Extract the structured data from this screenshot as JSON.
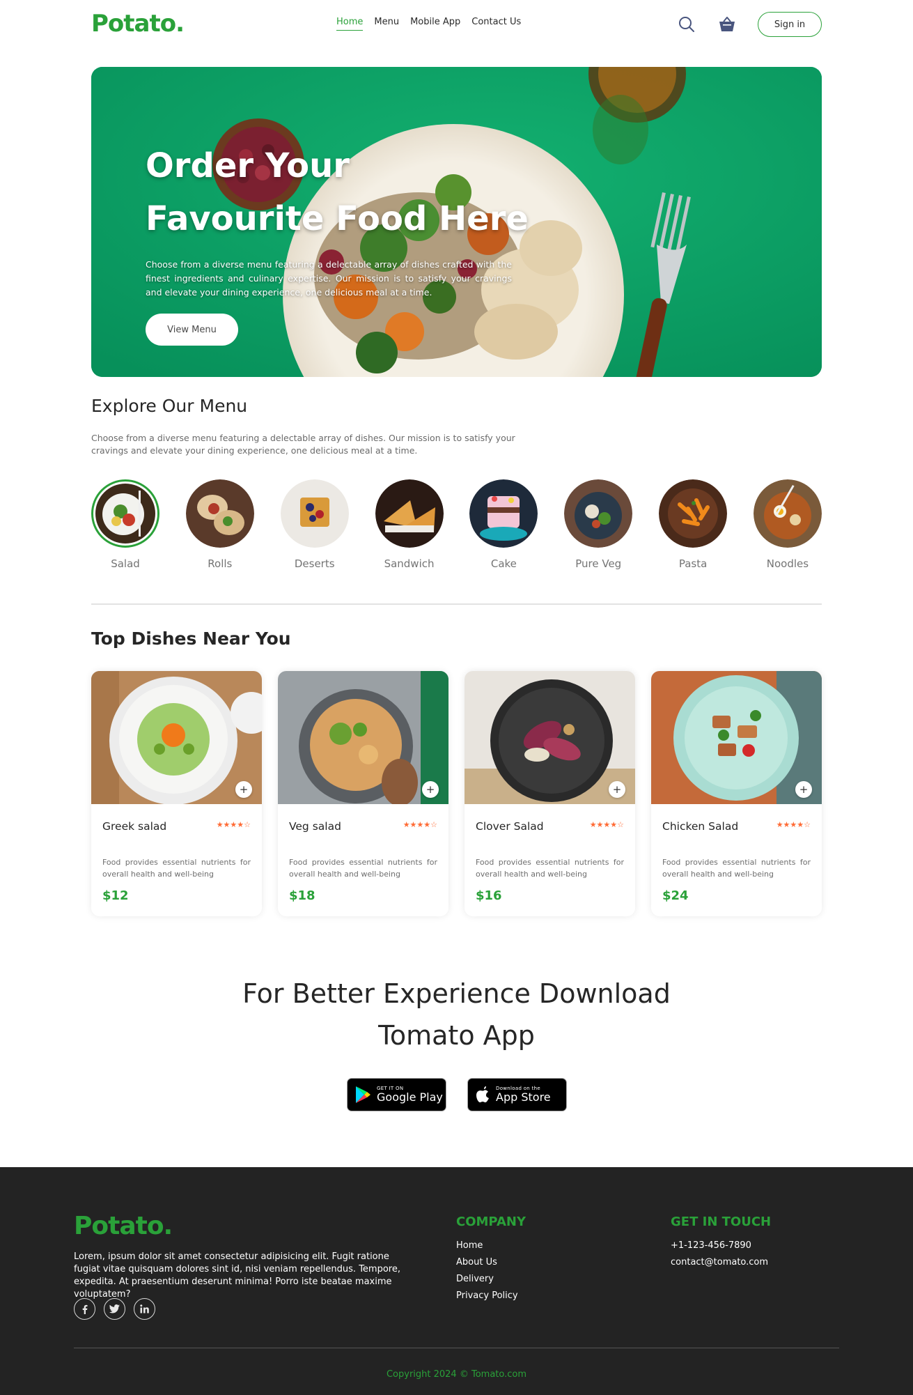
{
  "navbar": {
    "logo": "Potato.",
    "links": [
      "Home",
      "Menu",
      "Mobile App",
      "Contact Us"
    ],
    "active_link": "Home",
    "search_icon": "search-icon",
    "basket_icon": "basket-icon",
    "signin_label": "Sign in"
  },
  "hero": {
    "title": "Order Your Favourite Food Here",
    "description": "Choose from a diverse menu featuring a delectable array of dishes crafted with the finest ingredients and culinary expertise. Our mission is to satisfy your cravings and elevate your dining experience, one delicious meal at a time.",
    "button_label": "View Menu"
  },
  "explore": {
    "title": "Explore Our Menu",
    "description": "Choose from a diverse menu featuring a delectable array of dishes. Our mission is to satisfy your cravings and elevate your dining experience, one delicious meal at a time.",
    "categories": [
      {
        "label": "Salad",
        "active": true
      },
      {
        "label": "Rolls",
        "active": false
      },
      {
        "label": "Deserts",
        "active": false
      },
      {
        "label": "Sandwich",
        "active": false
      },
      {
        "label": "Cake",
        "active": false
      },
      {
        "label": "Pure Veg",
        "active": false
      },
      {
        "label": "Pasta",
        "active": false
      },
      {
        "label": "Noodles",
        "active": false
      }
    ]
  },
  "top_dishes": {
    "title": "Top Dishes Near You",
    "dishes": [
      {
        "name": "Greek salad",
        "rating": 4,
        "description": "Food provides essential nutrients for overall health and well-being",
        "price": "$12"
      },
      {
        "name": "Veg salad",
        "rating": 4,
        "description": "Food provides essential nutrients for overall health and well-being",
        "price": "$18"
      },
      {
        "name": "Clover Salad",
        "rating": 4,
        "description": "Food provides essential nutrients for overall health and well-being",
        "price": "$16"
      },
      {
        "name": "Chicken Salad",
        "rating": 4,
        "description": "Food provides essential nutrients for overall health and well-being",
        "price": "$24"
      }
    ]
  },
  "app_download": {
    "title": "For Better Experience Download Tomato App",
    "google_play_small": "GET IT ON",
    "google_play_big": "Google Play",
    "app_store_small": "Download on the",
    "app_store_big": "App Store"
  },
  "footer": {
    "logo": "Potato.",
    "description": "Lorem, ipsum dolor sit amet consectetur adipisicing elit. Fugit ratione fugiat vitae quisquam dolores sint id, nisi veniam repellendus. Tempore, expedita. At praesentium deserunt minima! Porro iste beatae maxime voluptatem?",
    "social": [
      "facebook-icon",
      "twitter-icon",
      "linkedin-icon"
    ],
    "company_title": "COMPANY",
    "company_links": [
      "Home",
      "About Us",
      "Delivery",
      "Privacy Policy"
    ],
    "contact_title": "GET IN TOUCH",
    "phone": "+1-123-456-7890",
    "email": "contact@tomato.com",
    "copyright": "Copyright 2024 © Tomato.com"
  },
  "colors": {
    "brand_green": "#2aa139",
    "hero_green": "#0aa064",
    "star_orange": "#ff6b35",
    "footer_bg": "#232323"
  }
}
